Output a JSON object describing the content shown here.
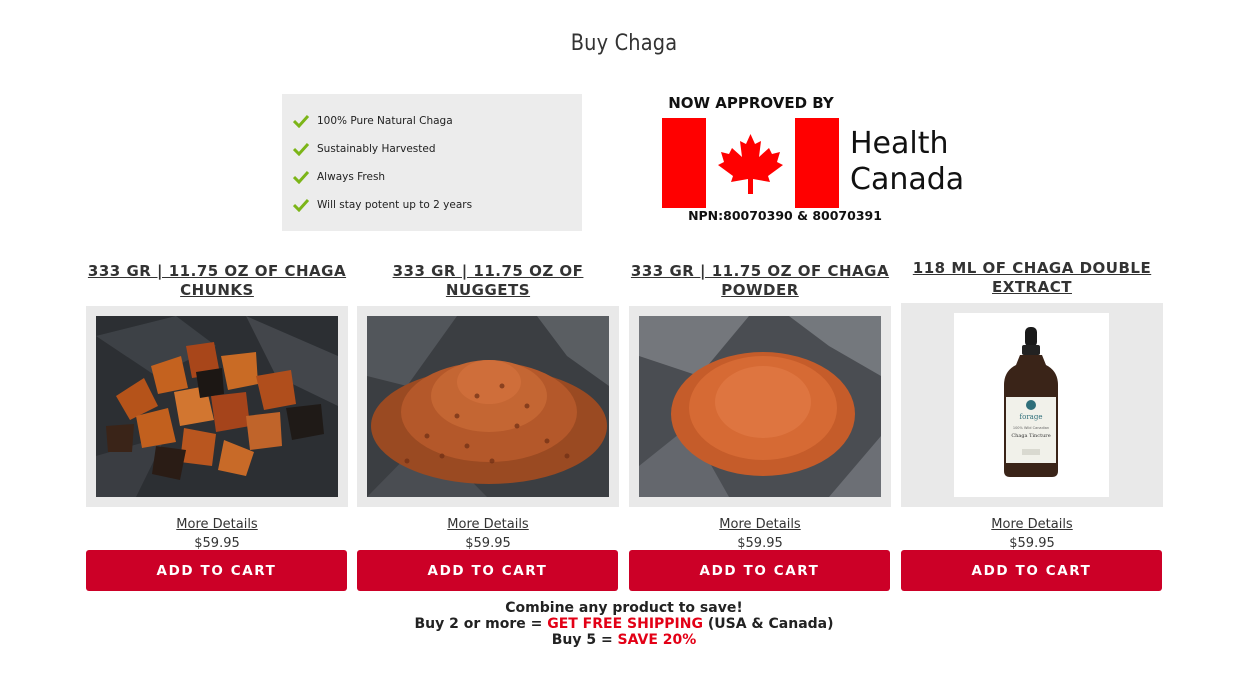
{
  "page": {
    "title": "Buy Chaga"
  },
  "benefits": [
    "100% Pure Natural Chaga",
    "Sustainably Harvested",
    "Always Fresh",
    "Will stay potent up to 2 years"
  ],
  "health_canada": {
    "approved": "NOW APPROVED BY",
    "name_line1": "Health",
    "name_line2": "Canada",
    "npn": "NPN:80070390 & 80070391"
  },
  "products": [
    {
      "title": "333 GR | 11.75 OZ OF CHAGA CHUNKS",
      "more": "More Details",
      "price": "$59.95",
      "button": "ADD TO CART"
    },
    {
      "title": "333 GR | 11.75 OZ OF NUGGETS",
      "more": "More Details",
      "price": "$59.95",
      "button": "ADD TO CART"
    },
    {
      "title": "333 GR | 11.75 OZ OF CHAGA POWDER",
      "more": "More Details",
      "price": "$59.95",
      "button": "ADD TO CART"
    },
    {
      "title": "118 ML OF CHAGA DOUBLE EXTRACT",
      "more": "More Details",
      "price": "$59.95",
      "button": "ADD TO CART"
    }
  ],
  "bottle_label": {
    "brand": "forage",
    "line1": "100% Wild Canadian",
    "line2": "Chaga Tincture"
  },
  "promo": {
    "line1": "Combine any product to save!",
    "line2_prefix": "Buy 2 or more = ",
    "line2_highlight": "GET FREE SHIPPING",
    "line2_suffix": " (USA & Canada)",
    "line3_prefix": "Buy 5 = ",
    "line3_highlight": "SAVE 20%"
  },
  "colors": {
    "button": "#cc0027",
    "highlight": "#e30016",
    "check": "#7cb518",
    "flag_red": "#ff0000"
  }
}
